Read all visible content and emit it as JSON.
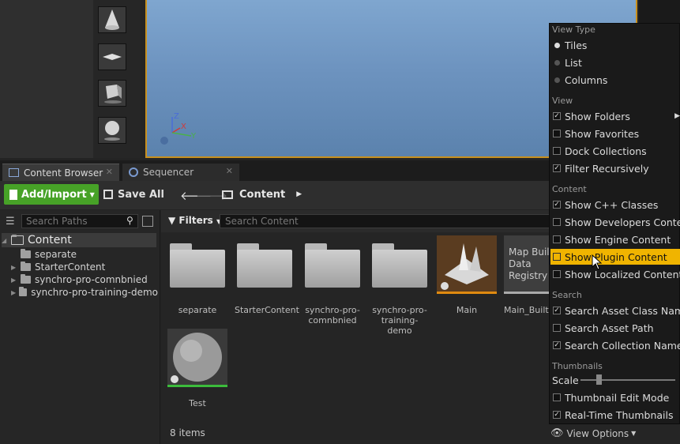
{
  "tabs": [
    {
      "label": "Content Browser",
      "close": "✕"
    },
    {
      "label": "Sequencer",
      "close": "✕"
    }
  ],
  "toolbar": {
    "add_import": "Add/Import",
    "save_all": "Save All",
    "path": "Content"
  },
  "sources": {
    "search_placeholder": "Search Paths",
    "root": "Content",
    "folders": [
      "separate",
      "StarterContent",
      "synchro-pro-comnbnied",
      "synchro-pro-training-demo"
    ]
  },
  "content": {
    "filters_label": "Filters",
    "search_placeholder": "Search Content",
    "items": [
      {
        "label": "separate"
      },
      {
        "label": "StarterContent"
      },
      {
        "label": "synchro-pro-comnbnied"
      },
      {
        "label": "synchro-pro-training-demo"
      },
      {
        "label": "Main"
      },
      {
        "label": "Main_BuiltD",
        "thumb_text": "Map Build Data Registry"
      },
      {
        "label": "Test"
      }
    ],
    "count": "8 items"
  },
  "menu": {
    "view_type_header": "View Type",
    "view_type": [
      {
        "label": "Tiles",
        "selected": true
      },
      {
        "label": "List",
        "selected": false
      },
      {
        "label": "Columns",
        "selected": false
      }
    ],
    "view_header": "View",
    "view": [
      {
        "label": "Show Folders",
        "checked": true
      },
      {
        "label": "Show Favorites",
        "checked": false
      },
      {
        "label": "Dock Collections",
        "checked": false
      },
      {
        "label": "Filter Recursively",
        "checked": true
      }
    ],
    "content_header": "Content",
    "content": [
      {
        "label": "Show C++ Classes",
        "checked": true
      },
      {
        "label": "Show Developers Content",
        "checked": false
      },
      {
        "label": "Show Engine Content",
        "checked": false
      },
      {
        "label": "Show Plugin Content",
        "checked": false,
        "highlighted": true
      },
      {
        "label": "Show Localized Content",
        "checked": false
      }
    ],
    "search_header": "Search",
    "search": [
      {
        "label": "Search Asset Class Names",
        "checked": true
      },
      {
        "label": "Search Asset Path",
        "checked": false
      },
      {
        "label": "Search Collection Names",
        "checked": true
      }
    ],
    "thumbnails_header": "Thumbnails",
    "scale_label": "Scale",
    "thumbnails": [
      {
        "label": "Thumbnail Edit Mode",
        "checked": false
      },
      {
        "label": "Real-Time Thumbnails",
        "checked": true
      }
    ]
  },
  "view_options": "View Options",
  "gizmo": {
    "z": "Z",
    "x": "X",
    "y": "Y"
  },
  "colors": {
    "accent_green": "#47a227",
    "highlight": "#f0b400",
    "viewport_border": "#c8901e"
  }
}
